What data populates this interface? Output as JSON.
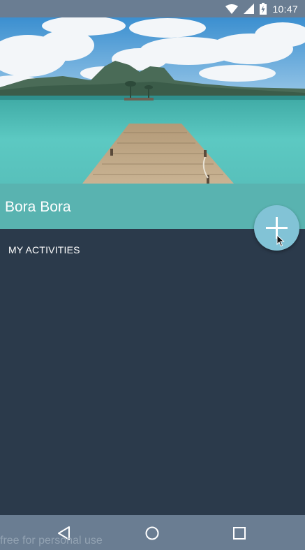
{
  "status_bar": {
    "time": "10:47",
    "icons": [
      "wifi-icon",
      "cell-signal-icon",
      "battery-icon"
    ]
  },
  "hero": {
    "image": "tropical lagoon with wooden dock"
  },
  "place": {
    "title": "Bora Bora"
  },
  "fab": {
    "icon": "plus-icon"
  },
  "activities": {
    "header": "MY ACTIVITIES"
  },
  "nav_bar": {
    "buttons": [
      "back-icon",
      "home-icon",
      "recents-icon"
    ]
  },
  "watermark": {
    "text": "free for personal use"
  },
  "colors": {
    "status_bar": "#6a7d92",
    "title_band": "#59b3b0",
    "content_bg": "#2b3a4b",
    "fab": "#82c3d6"
  }
}
